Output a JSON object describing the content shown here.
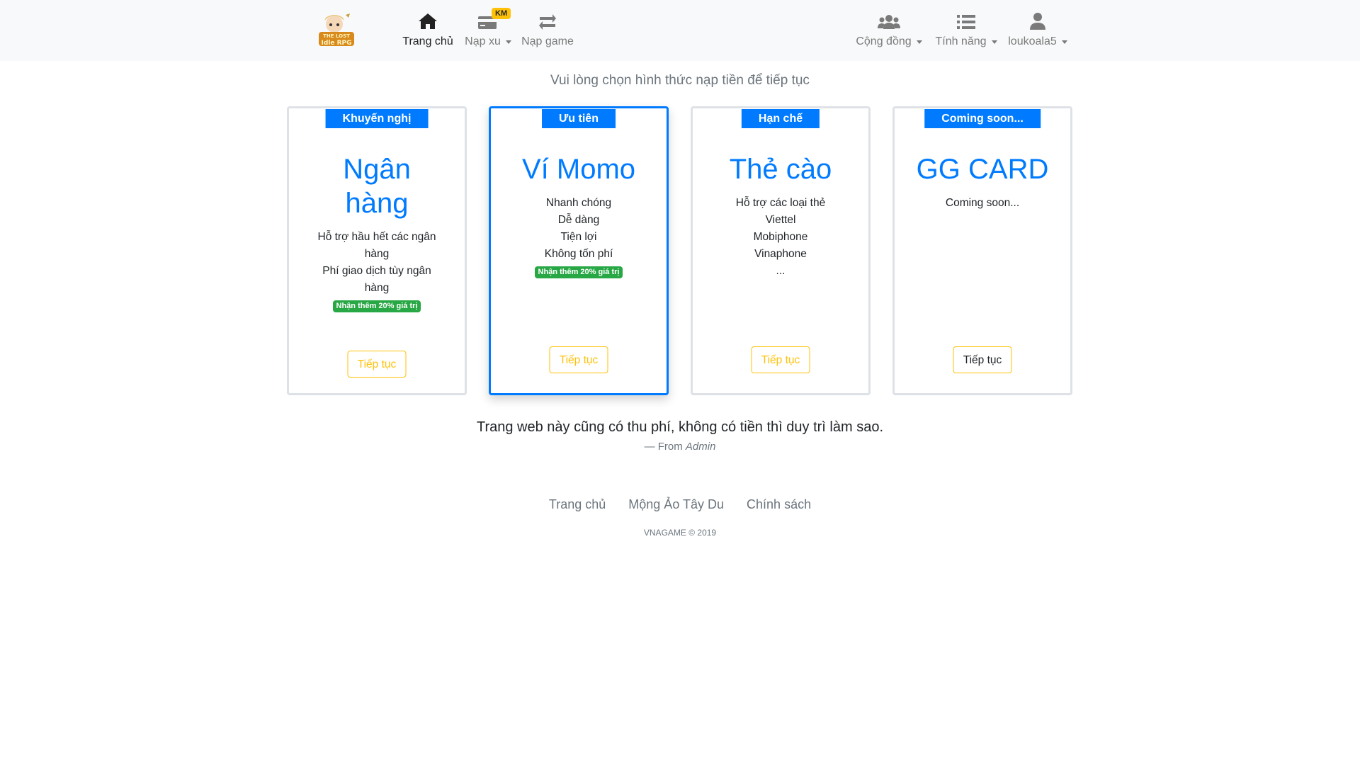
{
  "nav": {
    "home_label": "Trang chủ",
    "topup_xu_label": "Nạp xu",
    "km_badge": "KM",
    "topup_game_label": "Nạp game",
    "community_label": "Cộng đồng",
    "features_label": "Tính năng",
    "username": "loukoala5",
    "logo_text_1": "THE LOST",
    "logo_text_2": "Idle RPG"
  },
  "main": {
    "instruction": "Vui lòng chọn hình thức nạp tiền để tiếp tục"
  },
  "cards": [
    {
      "badge": "Khuyến nghị",
      "title_line1": "Ngân",
      "title_line2": "hàng",
      "desc": [
        "Hỗ trợ hầu hết các ngân",
        "hàng",
        "Phí giao dịch tùy ngân",
        "hàng"
      ],
      "promo": "Nhận thêm 20% giá trị",
      "button": "Tiếp tục"
    },
    {
      "badge": "Ưu tiên",
      "title": "Ví Momo",
      "desc": [
        "Nhanh chóng",
        "Dễ dàng",
        "Tiện lợi",
        "Không tốn phí"
      ],
      "promo": "Nhận thêm 20% giá trị",
      "button": "Tiếp tục"
    },
    {
      "badge": "Hạn chế",
      "title": "Thẻ cào",
      "desc": [
        "Hỗ trợ các loại thẻ",
        "Viettel",
        "Mobiphone",
        "Vinaphone",
        "..."
      ],
      "button": "Tiếp tục"
    },
    {
      "badge": "Coming soon...",
      "title": "GG CARD",
      "desc": [
        "Coming soon..."
      ],
      "button": "Tiếp tục"
    }
  ],
  "quote": {
    "text": "Trang web này cũng có thu phí, không có tiền thì duy trì làm sao.",
    "source_prefix": "— From",
    "source_name": "Admin"
  },
  "footer": {
    "links": [
      "Trang chủ",
      "Mộng Ảo Tây Du",
      "Chính sách"
    ],
    "copyright": "VNAGAME © 2019"
  },
  "colors": {
    "primary": "#007bff",
    "warning": "#ffc107",
    "success": "#28a745",
    "muted": "#6c757d"
  },
  "icons": {
    "home": "home-icon",
    "topup_xu": "credit-card-icon",
    "topup_game": "exchange-arrows-icon",
    "community": "users-icon",
    "features": "list-icon",
    "user": "user-icon"
  }
}
